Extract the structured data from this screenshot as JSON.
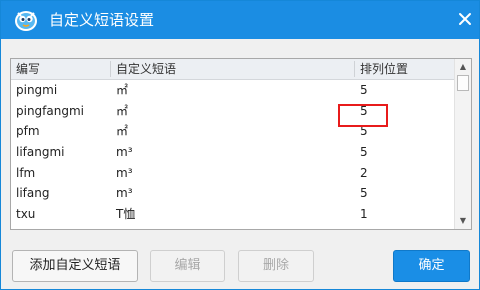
{
  "window": {
    "title": "自定义短语设置",
    "accent_color": "#1b8de3",
    "app_icon": "sogou-mascot-icon",
    "close_icon": "close-icon"
  },
  "table": {
    "columns": [
      "编写",
      "自定义短语",
      "排列位置"
    ],
    "rows": [
      {
        "code": "pingmi",
        "phrase": "㎡",
        "position": "5"
      },
      {
        "code": "pingfangmi",
        "phrase": "㎡",
        "position": "5"
      },
      {
        "code": "pfm",
        "phrase": "㎡",
        "position": "5"
      },
      {
        "code": "lifangmi",
        "phrase": "m³",
        "position": "5"
      },
      {
        "code": "lfm",
        "phrase": "m³",
        "position": "2"
      },
      {
        "code": "lifang",
        "phrase": "m³",
        "position": "5"
      },
      {
        "code": "txu",
        "phrase": "T恤",
        "position": "1"
      }
    ],
    "highlight_color": "#e81b1b"
  },
  "buttons": {
    "add": "添加自定义短语",
    "edit": "编辑",
    "delete": "删除",
    "ok": "确定"
  }
}
